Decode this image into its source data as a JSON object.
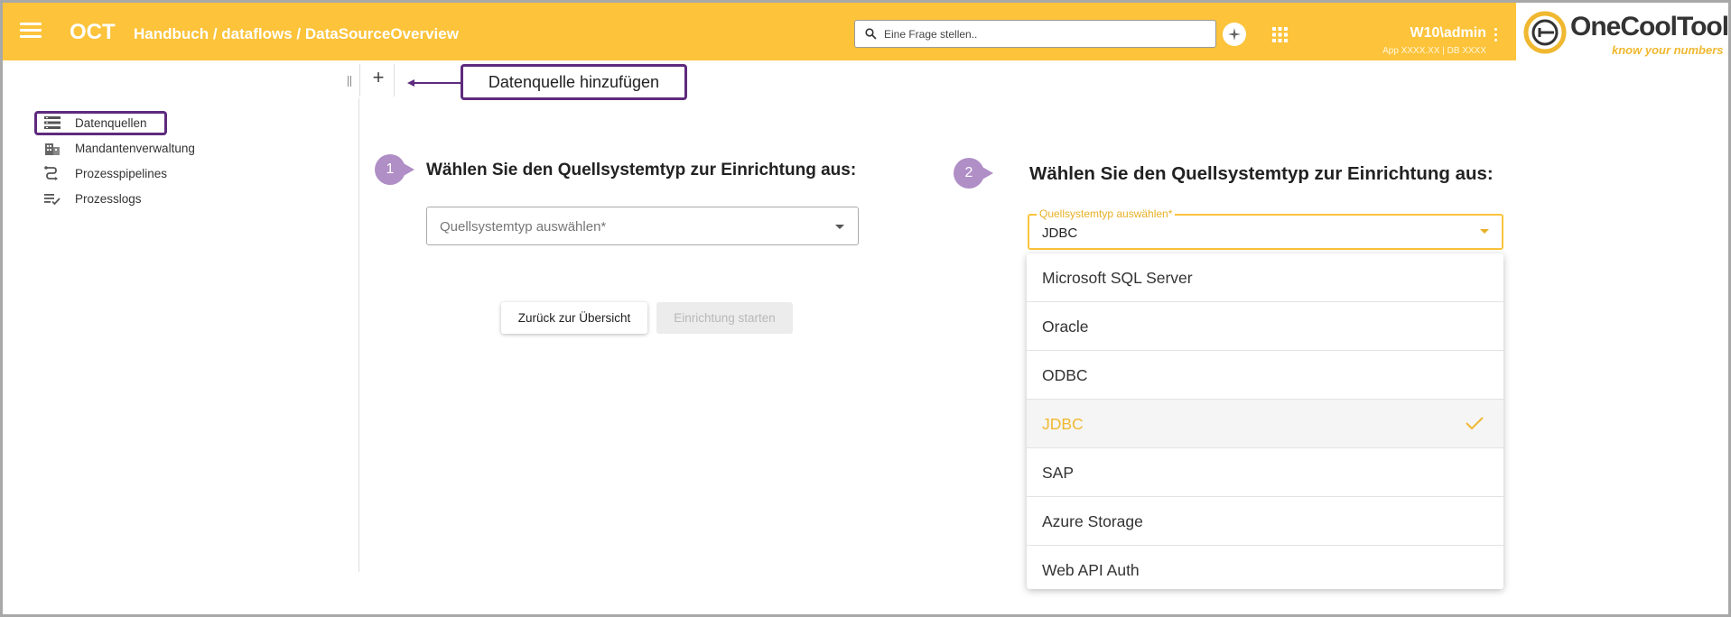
{
  "header": {
    "app_abbr": "OCT",
    "breadcrumb": "Handbuch / dataflows / DataSourceOverview",
    "search_placeholder": "Eine Frage stellen..",
    "user_name": "W10\\admin",
    "app_info": "App XXXX.XX | DB XXXX",
    "accent_color": "#fcc33b"
  },
  "logo": {
    "brand": "OneCoolTool",
    "tagline": "know your numbers"
  },
  "toolbar": {
    "add_label": "+",
    "callout": "Datenquelle hinzufügen"
  },
  "sidebar": {
    "items": [
      {
        "label": "Datenquellen",
        "icon": "list-icon"
      },
      {
        "label": "Mandantenverwaltung",
        "icon": "building-icon"
      },
      {
        "label": "Prozesspipelines",
        "icon": "pipeline-icon"
      },
      {
        "label": "Prozesslogs",
        "icon": "log-list-icon"
      }
    ]
  },
  "step1": {
    "badge": "1",
    "title": "Wählen Sie den Quellsystemtyp zur Einrichtung aus:",
    "select_placeholder": "Quellsystemtyp auswählen*",
    "back_button": "Zurück zur Übersicht",
    "start_button": "Einrichtung starten"
  },
  "step2": {
    "badge": "2",
    "title": "Wählen Sie den Quellsystemtyp zur Einrichtung aus:",
    "select_label": "Quellsystemtyp auswählen*",
    "select_value": "JDBC",
    "options": [
      "Microsoft SQL Server",
      "Oracle",
      "ODBC",
      "JDBC",
      "SAP",
      "Azure Storage",
      "Web API Auth"
    ],
    "selected_option": "JDBC"
  },
  "colors": {
    "annotation": "#5e2a7e",
    "badge": "#b08ec6",
    "selected_text": "#f0b830"
  }
}
